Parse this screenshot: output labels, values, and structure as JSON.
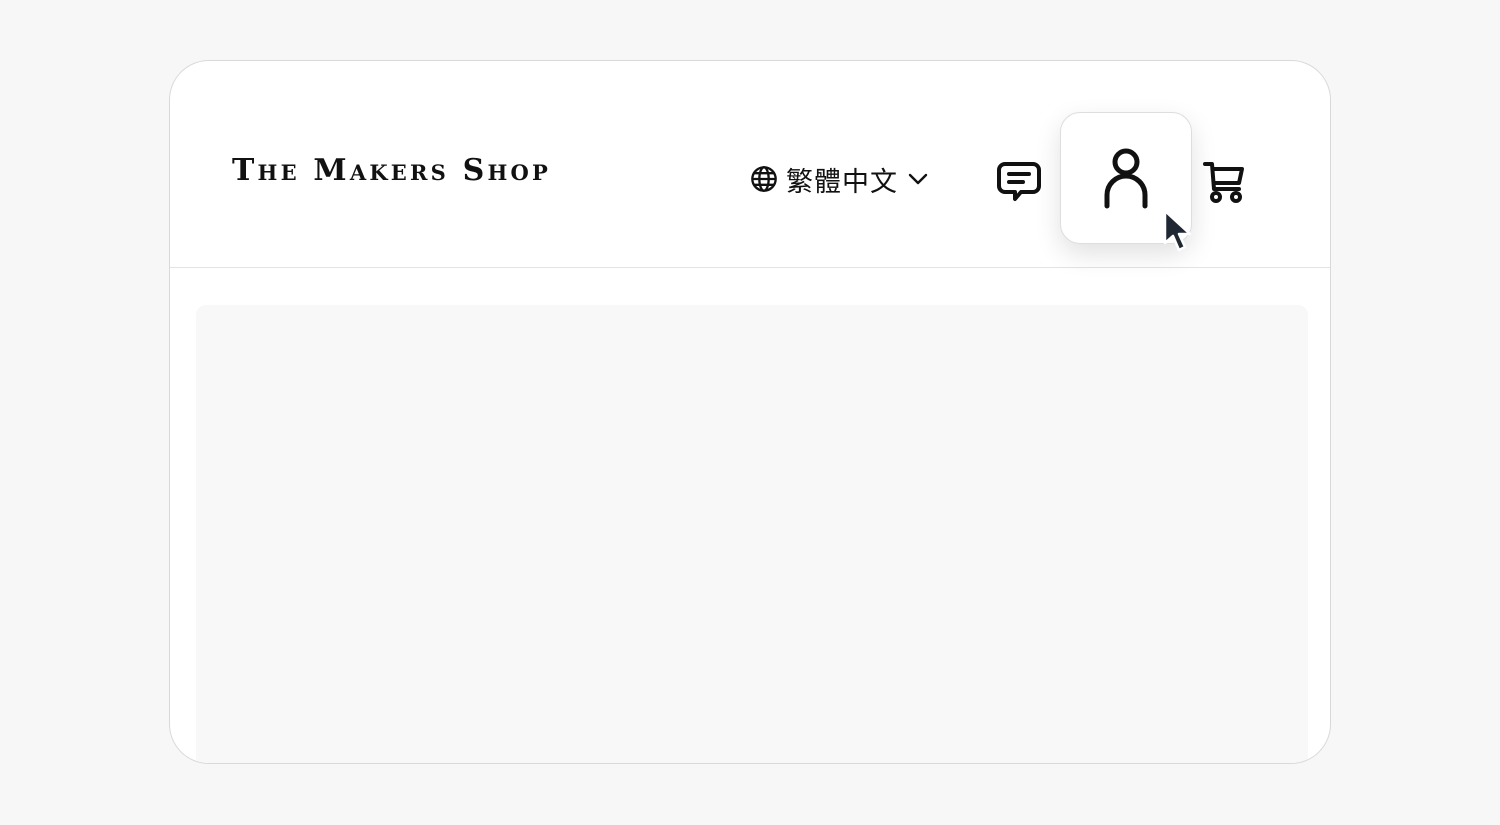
{
  "header": {
    "logo": "The Makers Shop",
    "language": {
      "icon": "globe-icon",
      "label": "繁體中文",
      "dropdown_icon": "chevron-down-icon"
    },
    "icons": {
      "messages": "chat-message-icon",
      "account": "user-account-icon",
      "cart": "shopping-cart-icon",
      "cursor": "mouse-pointer-icon"
    }
  },
  "colors": {
    "page_background": "#f7f7f7",
    "window_background": "#ffffff",
    "content_placeholder": "#f8f8f8",
    "text": "#111111"
  }
}
